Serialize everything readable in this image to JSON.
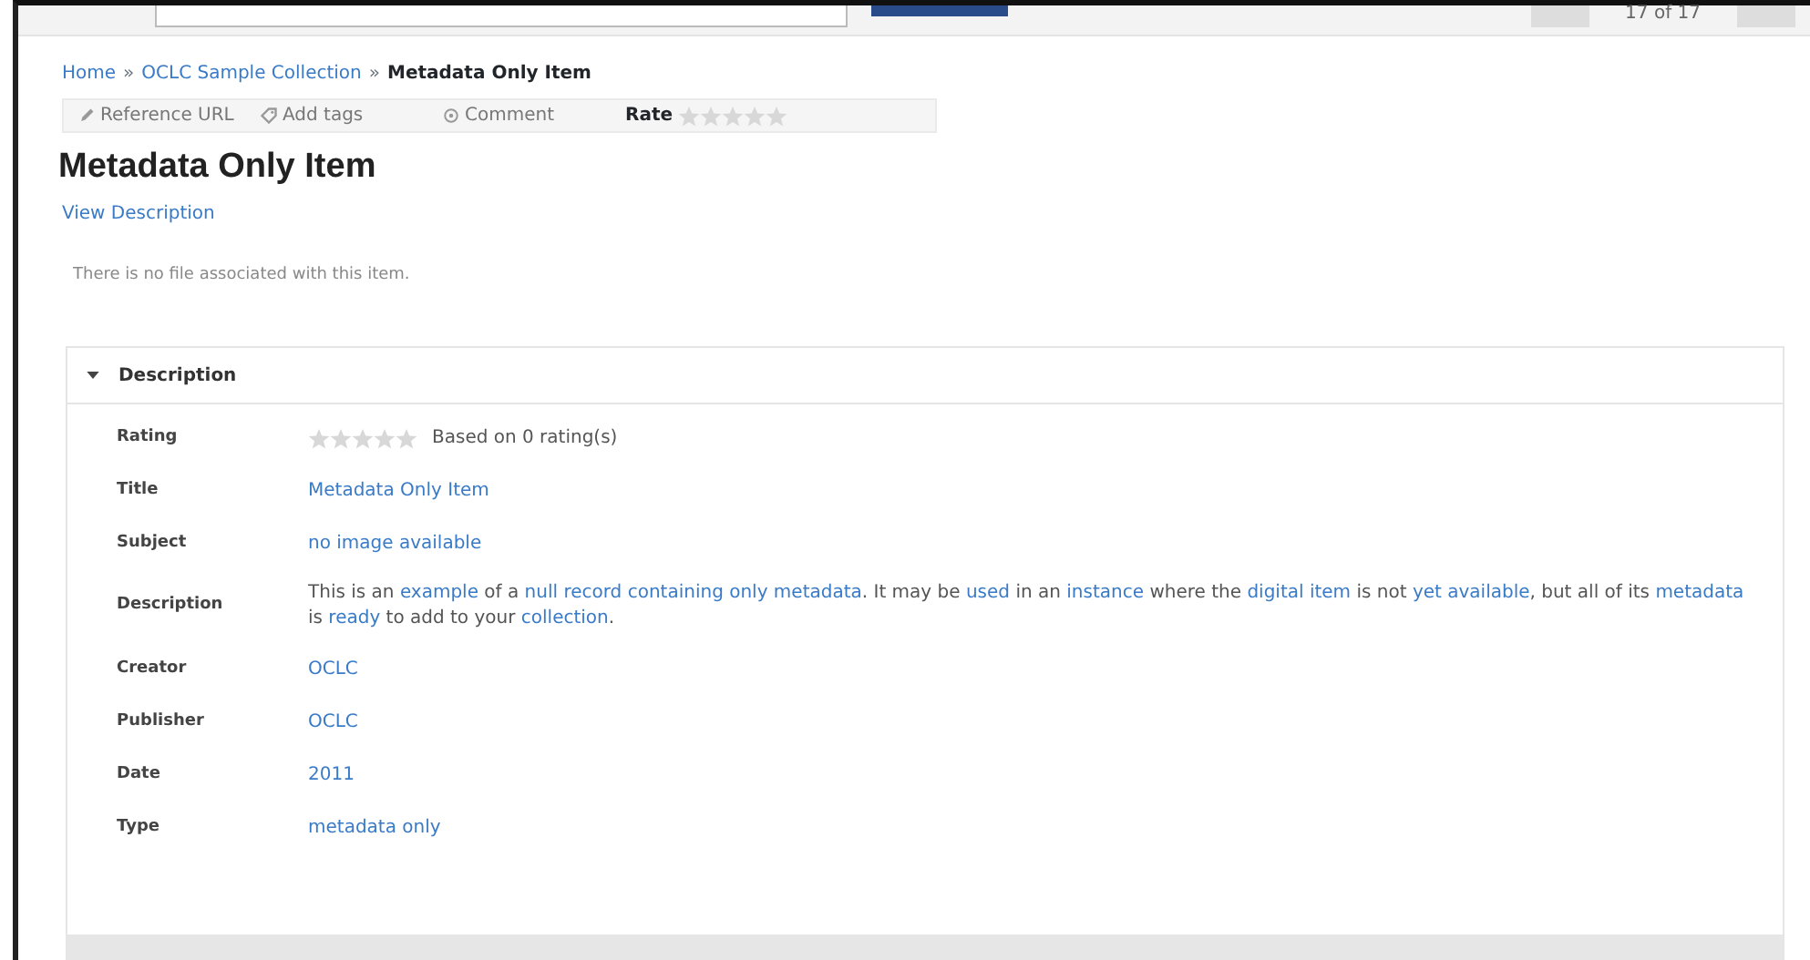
{
  "top_bar": {
    "pager": "17 of 17"
  },
  "breadcrumb": [
    {
      "label": "Home",
      "current": false
    },
    {
      "label": "OCLC Sample Collection",
      "current": false
    },
    {
      "label": "Metadata Only Item",
      "current": true
    }
  ],
  "breadcrumb_separator": "»",
  "toolbar": [
    {
      "kind": "link",
      "label": "Reference URL"
    },
    {
      "kind": "link",
      "label": "Add tags"
    },
    {
      "kind": "link",
      "label": "Comment"
    },
    {
      "kind": "rate",
      "label": "Rate",
      "stars": 0
    }
  ],
  "item_title": "Metadata Only Item",
  "view_description": "View Description",
  "no_file_note": "There is no file associated with this item.",
  "description_panel": {
    "title": "Description",
    "expanded": true,
    "fields": [
      {
        "kind": "rating",
        "label": "Rating",
        "stars": 0,
        "text": "Based on 0 rating(s)"
      },
      {
        "kind": "link",
        "label": "Title",
        "value": "Metadata Only Item"
      },
      {
        "kind": "link",
        "label": "Subject",
        "value": "no image available"
      },
      {
        "kind": "mixed",
        "label": "Description",
        "segments": [
          {
            "text": "This is an ",
            "link": false
          },
          {
            "text": "example",
            "link": true
          },
          {
            "text": " of a ",
            "link": false
          },
          {
            "text": "null record containing only metadata",
            "link": true
          },
          {
            "text": ". It may be ",
            "link": false
          },
          {
            "text": "used",
            "link": true
          },
          {
            "text": " in an ",
            "link": false
          },
          {
            "text": "instance",
            "link": true
          },
          {
            "text": " where the ",
            "link": false
          },
          {
            "text": "digital item",
            "link": true
          },
          {
            "text": " is not ",
            "link": false
          },
          {
            "text": "yet available",
            "link": true
          },
          {
            "text": ", but all of its ",
            "link": false
          },
          {
            "text": "metadata",
            "link": true
          },
          {
            "text": " is ",
            "link": false
          },
          {
            "text": "ready",
            "link": true
          },
          {
            "text": " to add to your ",
            "link": false
          },
          {
            "text": "collection",
            "link": true
          },
          {
            "text": ".",
            "link": false
          }
        ]
      },
      {
        "kind": "link",
        "label": "Creator",
        "value": "OCLC"
      },
      {
        "kind": "link",
        "label": "Publisher",
        "value": "OCLC"
      },
      {
        "kind": "link",
        "label": "Date",
        "value": "2011"
      },
      {
        "kind": "link",
        "label": "Type",
        "value": "metadata only"
      }
    ]
  }
}
